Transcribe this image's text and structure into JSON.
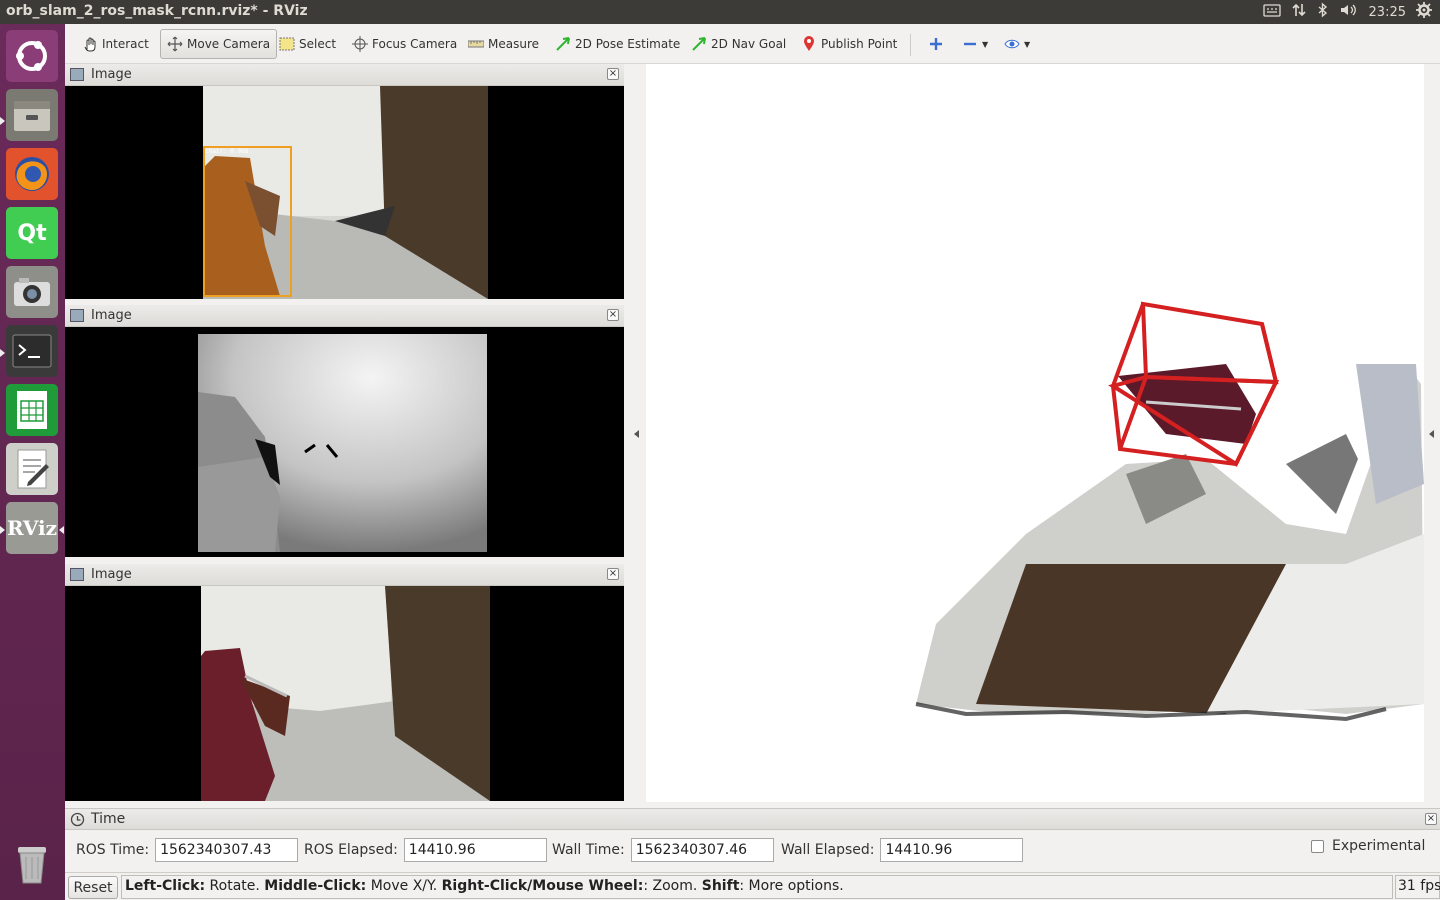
{
  "window": {
    "title": "orb_slam_2_ros_mask_rcnn.rviz* - RViz"
  },
  "tray": {
    "time": "23:25"
  },
  "launcher": {
    "items": [
      "Ubuntu",
      "Files",
      "Firefox",
      "Qt",
      "Camera",
      "Terminal",
      "Calc",
      "Text Editor",
      "RViz",
      "Trash"
    ],
    "qt_label": "Qt",
    "rviz_label": "RViz"
  },
  "toolbar": {
    "interact": "Interact",
    "move_camera": "Move Camera",
    "select": "Select",
    "focus_camera": "Focus Camera",
    "measure": "Measure",
    "pose_estimate": "2D Pose Estimate",
    "nav_goal": "2D Nav Goal",
    "publish_point": "Publish Point"
  },
  "panels": [
    {
      "title": "Image",
      "detection_label": "chair: 0.988"
    },
    {
      "title": "Image"
    },
    {
      "title": "Image"
    }
  ],
  "time_panel": {
    "title": "Time",
    "ros_time_label": "ROS Time:",
    "ros_time": "1562340307.43",
    "ros_elapsed_label": "ROS Elapsed:",
    "ros_elapsed": "14410.96",
    "wall_time_label": "Wall Time:",
    "wall_time": "1562340307.46",
    "wall_elapsed_label": "Wall Elapsed:",
    "wall_elapsed": "14410.96",
    "experimental_label": "Experimental"
  },
  "status": {
    "reset": "Reset",
    "left_click_key": "Left-Click:",
    "left_click_val": " Rotate. ",
    "middle_click_key": "Middle-Click:",
    "middle_click_val": " Move X/Y. ",
    "right_click_key": "Right-Click/Mouse Wheel:",
    "right_click_val": ": Zoom. ",
    "shift_key": "Shift",
    "shift_val": ": More options.",
    "fps": "31 fps"
  },
  "colors": {
    "launcher_bg": "#5e2750",
    "topbar_bg": "#3c3b37",
    "bbox": "#d42020",
    "detection_box": "#f0a020"
  }
}
